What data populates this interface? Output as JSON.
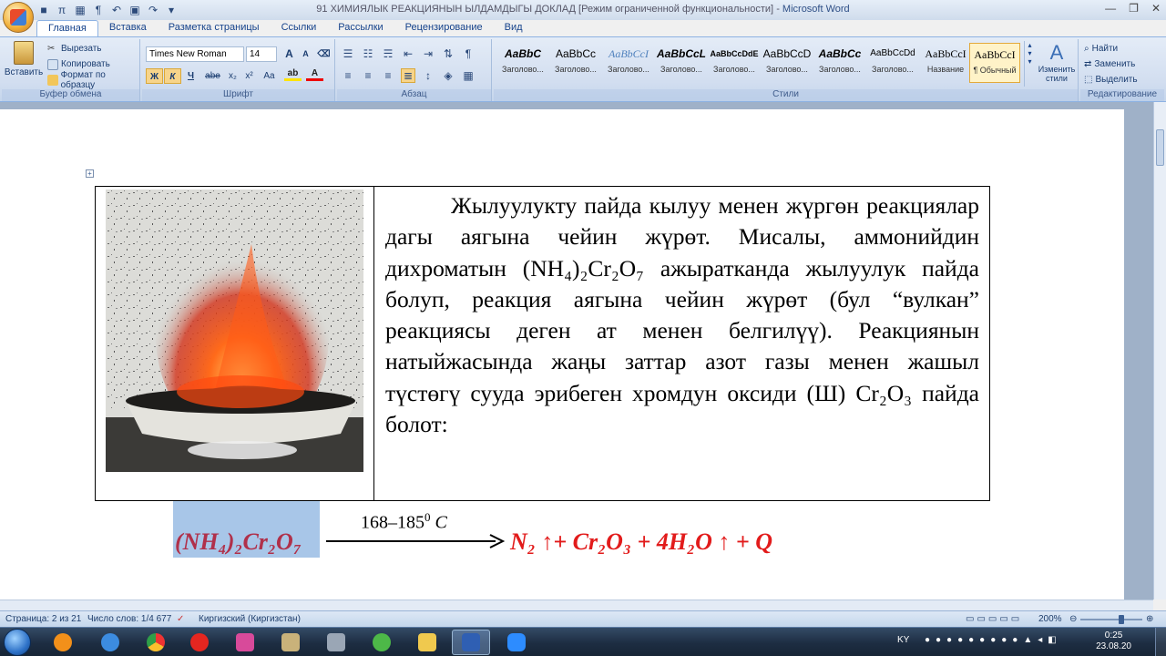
{
  "window": {
    "title": "91 ХИМИЯЛЫК РЕАКЦИЯНЫН ЫЛДАМДЫГЫ ДОКЛАД [Режим ограниченной функциональности]",
    "app_name": "Microsoft Word"
  },
  "tabs": [
    {
      "label": "Главная",
      "active": true
    },
    {
      "label": "Вставка"
    },
    {
      "label": "Разметка страницы"
    },
    {
      "label": "Ссылки"
    },
    {
      "label": "Рассылки"
    },
    {
      "label": "Рецензирование"
    },
    {
      "label": "Вид"
    }
  ],
  "clipboard": {
    "paste": "Вставить",
    "cut": "Вырезать",
    "copy": "Копировать",
    "format_painter": "Формат по образцу",
    "group": "Буфер обмена"
  },
  "font": {
    "name": "Times New Roman",
    "size": "14",
    "group": "Шрифт",
    "bold": "Ж",
    "italic": "К",
    "underline": "Ч",
    "strike": "abe",
    "subscript": "x₂",
    "superscript": "x²",
    "case": "Aa",
    "grow": "A",
    "shrink": "A"
  },
  "paragraph": {
    "group": "Абзац"
  },
  "styles": {
    "group": "Стили",
    "items": [
      {
        "sample": "AaBbC",
        "name": "Заголово..."
      },
      {
        "sample": "AaBbCc",
        "name": "Заголово..."
      },
      {
        "sample": "AaBbCcI",
        "name": "Заголово..."
      },
      {
        "sample": "AaBbCcL",
        "name": "Заголово..."
      },
      {
        "sample": "AaBbCcDdE",
        "name": "Заголово..."
      },
      {
        "sample": "AaBbCcD",
        "name": "Заголово..."
      },
      {
        "sample": "AaBbCc",
        "name": "Заголово..."
      },
      {
        "sample": "AaBbCcDd",
        "name": "Заголово..."
      },
      {
        "sample": "AaBbCcI",
        "name": "Название"
      },
      {
        "sample": "AaBbCcI",
        "name": "¶ Обычный",
        "selected": true
      }
    ],
    "change": "Изменить стили"
  },
  "editing": {
    "group": "Редактирование",
    "find": "Найти",
    "replace": "Заменить",
    "select": "Выделить"
  },
  "document": {
    "paragraph": "Жылуулукту пайда кылуу менен жүргөн реакциялар дагы аягына чейин жүрөт. Мисалы, аммонийдин дихроматын (NH₄)₂Cr₂O₇ ажыратканда жылуулук пайда болуп, реакция аягына чейин жүрөт (бул “вулкан” реакциясы деген ат менен белгилүү). Реакциянын натыйжасында жаңы заттар азот газы менен жашыл түстөгү сууда эрибеген хромдун оксиди (Ш) Cr₂O₃ пайда болот:",
    "reactant": "(NH₄)₂Cr₂O₇",
    "condition_value": "168–185",
    "condition_sup": "0",
    "condition_unit": "C",
    "products": "N₂ ↑+ Cr₂O₃ + 4H₂O ↑ +  Q"
  },
  "status": {
    "page": "Страница: 2 из 21",
    "words": "Число слов: 1/4 677",
    "language": "Киргизский (Киргизстан)",
    "zoom": "200%"
  },
  "taskbar": {
    "lang": "KY",
    "time": "0:25",
    "date": "23.08.20"
  }
}
